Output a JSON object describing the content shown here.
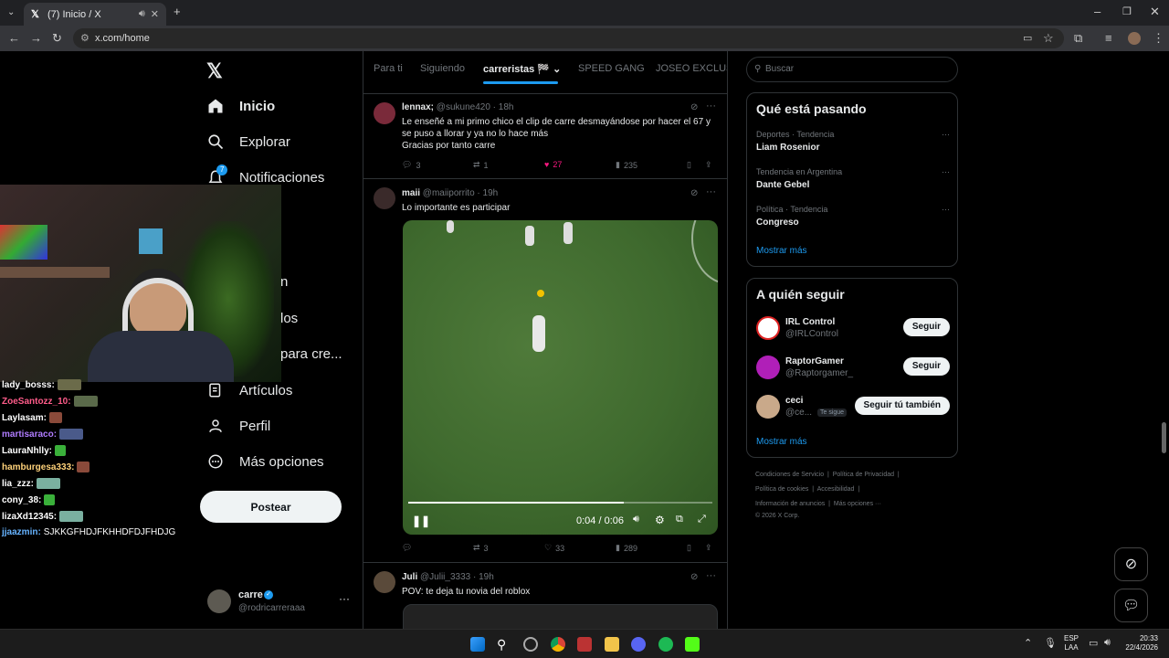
{
  "browser": {
    "tab_title": "(7) Inicio / X",
    "url": "x.com/home"
  },
  "nav": {
    "items": [
      {
        "label": "Inicio",
        "icon": "home-icon"
      },
      {
        "label": "Explorar",
        "icon": "search-icon"
      },
      {
        "label": "Notificaciones",
        "icon": "bell-icon",
        "badge": "7"
      },
      {
        "label": "n",
        "icon": ""
      },
      {
        "label": "los",
        "icon": ""
      },
      {
        "label": "para cre...",
        "icon": ""
      },
      {
        "label": "Artículos",
        "icon": "article-icon"
      },
      {
        "label": "Perfil",
        "icon": "person-icon"
      },
      {
        "label": "Más opciones",
        "icon": "more-circle-icon"
      }
    ],
    "post_button": "Postear",
    "account": {
      "name": "carre",
      "handle": "@rodricarreraaa"
    }
  },
  "feed": {
    "tabs": [
      "Para ti",
      "Siguiendo",
      "carreristas 🏁",
      "SPEED GANG",
      "JOSEO EXCLUSIV"
    ],
    "active_tab": 2,
    "tweets": [
      {
        "name": "lennax;",
        "handle": "@sukune420",
        "time": "18h",
        "lines": [
          "Le enseñé a mi primo chico el clip de carre desmayándose por hacer el 67 y",
          "se puso a llorar y ya no lo hace más",
          "Gracias por tanto carre"
        ],
        "replies": "3",
        "reposts": "1",
        "likes": "27",
        "views": "235"
      },
      {
        "name": "maii",
        "handle": "@maiiporrito",
        "time": "19h",
        "lines": [
          "Lo importante es participar"
        ],
        "video_time": "0:04 / 0:06",
        "progress": 0.71,
        "replies": "",
        "reposts": "3",
        "likes": "33",
        "views": "289"
      },
      {
        "name": "Juli",
        "handle": "@Julii_3333",
        "time": "19h",
        "lines": [
          "POV: te deja tu novia del roblox"
        ]
      }
    ]
  },
  "right": {
    "search_placeholder": "Buscar",
    "trends_title": "Qué está pasando",
    "trends": [
      {
        "context": "Deportes · Tendencia",
        "name": "Liam Rosenior"
      },
      {
        "context": "Tendencia en Argentina",
        "name": "Dante Gebel"
      },
      {
        "context": "Política · Tendencia",
        "name": "Congreso"
      }
    ],
    "show_more": "Mostrar más",
    "follow_title": "A quién seguir",
    "follows": [
      {
        "name": "IRL Control",
        "handle": "@IRLControl",
        "button": "Seguir",
        "color": "#ffffff"
      },
      {
        "name": "RaptorGamer",
        "handle": "@Raptorgamer_",
        "button": "Seguir",
        "color": "#b01fb8"
      },
      {
        "name": "ceci",
        "handle": "@ce...",
        "badge": "Te sigue",
        "button": "Seguir tú también",
        "color": "#c9a98a"
      }
    ],
    "footer": [
      "Condiciones de Servicio",
      "Política de Privacidad",
      "Política de cookies",
      "Accesibilidad",
      "Información de anuncios",
      "Más opciones ···",
      "© 2026 X Corp."
    ]
  },
  "chat": [
    {
      "user": "lady_bosss:",
      "color": "#ffffff",
      "text": ""
    },
    {
      "user": "ZoeSantozz_10:",
      "color": "#ff5c8a",
      "text": ""
    },
    {
      "user": "Laylasam:",
      "color": "#ffffff",
      "text": ""
    },
    {
      "user": "martisaraco:",
      "color": "#b07cff",
      "text": ""
    },
    {
      "user": "LauraNhlly:",
      "color": "#ffffff",
      "text": ""
    },
    {
      "user": "hamburgesa333:",
      "color": "#ffd27a",
      "text": ""
    },
    {
      "user": "lia_zzz:",
      "color": "#ffffff",
      "text": ""
    },
    {
      "user": "cony_38:",
      "color": "#ffffff",
      "text": ""
    },
    {
      "user": "lizaXd12345:",
      "color": "#ffffff",
      "text": ""
    },
    {
      "user": "jjaazmin:",
      "color": "#66b3ff",
      "text": "SJKKGFHDJFKHHDFDJFHDJG"
    }
  ],
  "taskbar": {
    "lang": "ESP",
    "region": "LAA",
    "time": "20:33",
    "date": "22/4/2026"
  }
}
